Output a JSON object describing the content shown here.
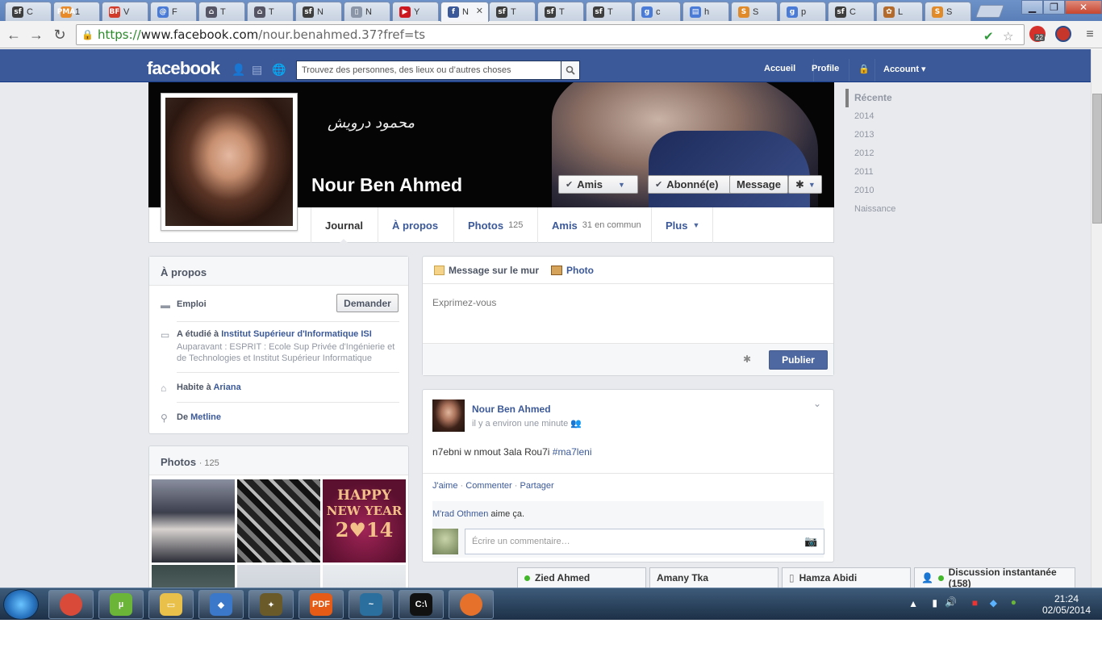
{
  "browser": {
    "tabs": [
      {
        "label": "C",
        "fav_text": "sf",
        "fav_color": "#3d3d3d"
      },
      {
        "label": "1",
        "fav_text": "PMA",
        "fav_color": "#e78a2a"
      },
      {
        "label": "V",
        "fav_text": "BF",
        "fav_color": "#d23a2a"
      },
      {
        "label": "F",
        "fav_text": "@",
        "fav_color": "#4a7bd6"
      },
      {
        "label": "T",
        "fav_text": "⌂",
        "fav_color": "#556"
      },
      {
        "label": "T",
        "fav_text": "⌂",
        "fav_color": "#556"
      },
      {
        "label": "N",
        "fav_text": "sf",
        "fav_color": "#3d3d3d"
      },
      {
        "label": "N",
        "fav_text": "▯",
        "fav_color": "#8a95a8"
      },
      {
        "label": "Y",
        "fav_text": "▶",
        "fav_color": "#cc181e"
      },
      {
        "label": "N",
        "fav_text": "f",
        "fav_color": "#3b5998"
      },
      {
        "label": "T",
        "fav_text": "sf",
        "fav_color": "#3d3d3d"
      },
      {
        "label": "T",
        "fav_text": "sf",
        "fav_color": "#3d3d3d"
      },
      {
        "label": "T",
        "fav_text": "sf",
        "fav_color": "#3d3d3d"
      },
      {
        "label": "c",
        "fav_text": "g",
        "fav_color": "#4a7bd6"
      },
      {
        "label": "h",
        "fav_text": "▤",
        "fav_color": "#4a7bd6"
      },
      {
        "label": "S",
        "fav_text": "S",
        "fav_color": "#e08a2a"
      },
      {
        "label": "p",
        "fav_text": "g",
        "fav_color": "#4a7bd6"
      },
      {
        "label": "C",
        "fav_text": "sf",
        "fav_color": "#3d3d3d"
      },
      {
        "label": "L",
        "fav_text": "✿",
        "fav_color": "#b36a2a"
      },
      {
        "label": "S",
        "fav_text": "S",
        "fav_color": "#e08a2a"
      }
    ],
    "active_tab_index": 9,
    "url_scheme": "https://",
    "url_host": "www.facebook.com",
    "url_path": "/nour.benahmed.37?fref=ts",
    "ext_badge": "22"
  },
  "fb": {
    "logo": "facebook",
    "search_placeholder": "Trouvez des personnes, des lieux ou d’autres choses",
    "nav": {
      "home": "Accueil",
      "profile": "Profile",
      "account": "Account"
    },
    "profile": {
      "name": "Nour Ben Ahmed",
      "cover_text": "محمود درويش",
      "friends_btn": "Amis",
      "follow_btn": "Abonné(e)",
      "message_btn": "Message"
    },
    "tabs": [
      {
        "label": "Journal",
        "count": ""
      },
      {
        "label": "À propos",
        "count": ""
      },
      {
        "label": "Photos",
        "count": "125"
      },
      {
        "label": "Amis",
        "count": "31 en commun"
      },
      {
        "label": "Plus",
        "count": ""
      }
    ],
    "about": {
      "title": "À propos",
      "work_label": "Emploi",
      "ask_btn": "Demander",
      "studied_prefix": "A étudié à",
      "studied_school": "Institut Supérieur d'Informatique ISI",
      "studied_prev": "Auparavant : ESPRIT : Ecole Sup Privée d'Ingénierie et de Technologies et Institut Supérieur Informatique",
      "lives_prefix": "Habite à",
      "lives_city": "Ariana",
      "from_prefix": "De",
      "from_city": "Metline"
    },
    "photos": {
      "title": "Photos",
      "count": "· 125",
      "thumb3_line1": "HAPPY",
      "thumb3_line2": "NEW YEAR",
      "thumb3_line3": "2♥14"
    },
    "composer": {
      "tab_status": "Message sur le mur",
      "tab_photo": "Photo",
      "placeholder": "Exprimez-vous",
      "publish": "Publier"
    },
    "post": {
      "author": "Nour Ben Ahmed",
      "time": "il y a environ une minute",
      "text": "n7ebni w nmout 3ala Rou7i",
      "hashtag": "#ma7leni",
      "like": "J'aime",
      "comment": "Commenter",
      "share": "Partager",
      "liked_by": "M'rad Othmen",
      "liked_suffix": "aime ça.",
      "comment_placeholder": "Écrire un commentaire…"
    },
    "rail": [
      "Récente",
      "2014",
      "2013",
      "2012",
      "2011",
      "2010",
      "Naissance"
    ],
    "chat": [
      {
        "name": "Zied Ahmed"
      },
      {
        "name": "Amany Tka"
      },
      {
        "name": "Hamza Abidi"
      },
      {
        "name": "Discussion instantanée (158)"
      }
    ]
  },
  "taskbar": {
    "apps": [
      {
        "name": "chrome",
        "text": "",
        "color": "#d94a38"
      },
      {
        "name": "utorrent",
        "text": "µ",
        "color": "#6bb539"
      },
      {
        "name": "explorer",
        "text": "▭",
        "color": "#e8c04a"
      },
      {
        "name": "virtualbox",
        "text": "◆",
        "color": "#3b78c9"
      },
      {
        "name": "game",
        "text": "✦",
        "color": "#6a5a2a"
      },
      {
        "name": "pdf",
        "text": "PDF",
        "color": "#e65c16"
      },
      {
        "name": "mysql",
        "text": "~",
        "color": "#2a6f9e"
      },
      {
        "name": "cmd",
        "text": "C:\\",
        "color": "#111"
      },
      {
        "name": "firefox",
        "text": "",
        "color": "#e5712a"
      }
    ],
    "time": "21:24",
    "date": "02/05/2014"
  }
}
